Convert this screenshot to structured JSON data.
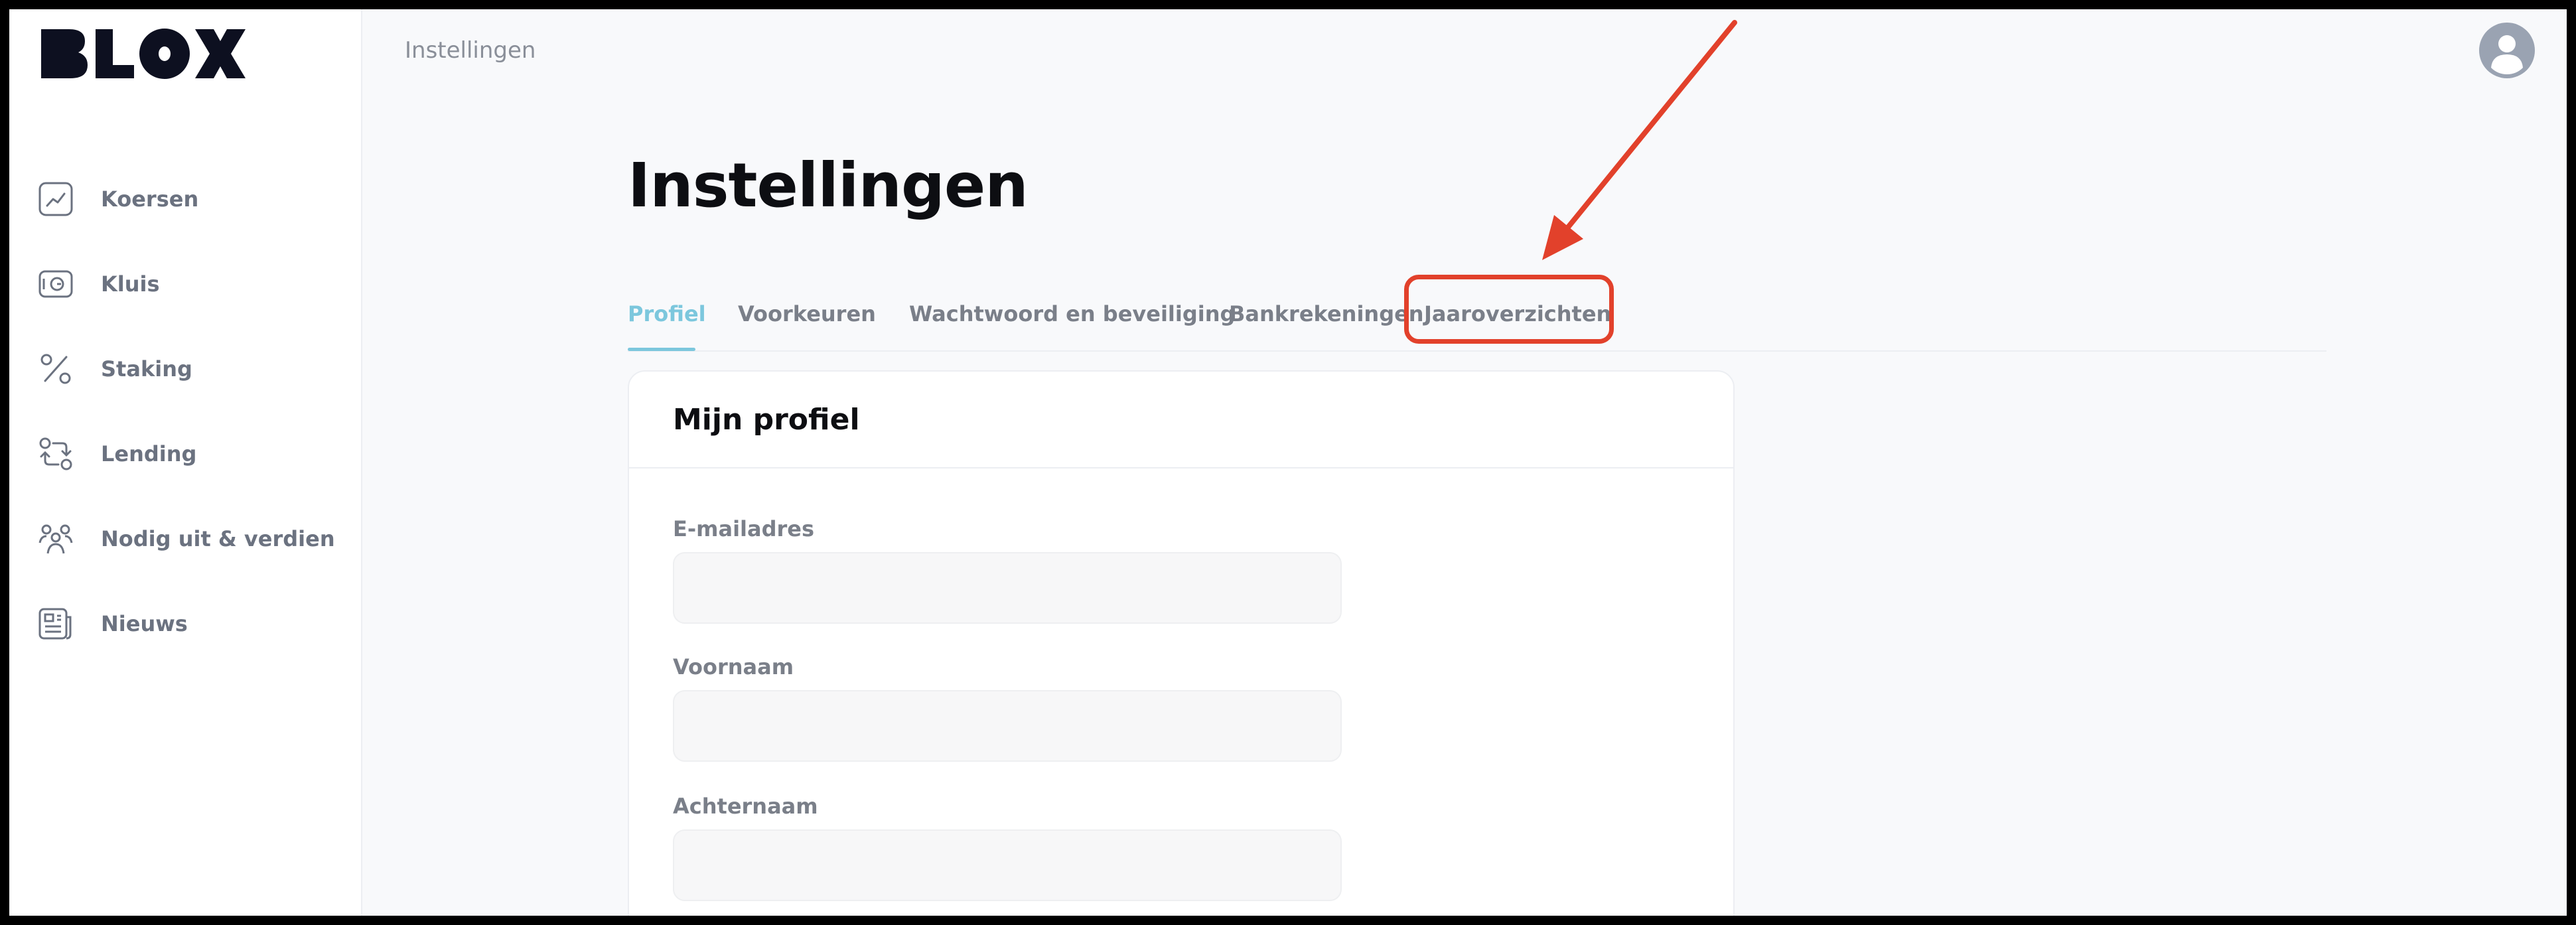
{
  "app": {
    "logo_text": "BLOX"
  },
  "header": {
    "breadcrumb": "Instellingen"
  },
  "sidebar": {
    "items": [
      {
        "label": "Koersen",
        "icon": "chart-icon"
      },
      {
        "label": "Kluis",
        "icon": "vault-icon"
      },
      {
        "label": "Staking",
        "icon": "percent-icon"
      },
      {
        "label": "Lending",
        "icon": "exchange-icon"
      },
      {
        "label": "Nodig uit & verdien",
        "icon": "users-icon"
      },
      {
        "label": "Nieuws",
        "icon": "newspaper-icon"
      }
    ]
  },
  "page": {
    "title": "Instellingen"
  },
  "tabs": [
    {
      "label": "Profiel",
      "active": true
    },
    {
      "label": "Voorkeuren",
      "active": false
    },
    {
      "label": "Wachtwoord en beveiliging",
      "active": false
    },
    {
      "label": "Bankrekeningen",
      "active": false
    },
    {
      "label": "Jaaroverzichten",
      "active": false
    }
  ],
  "profile_card": {
    "title": "Mijn profiel",
    "fields": [
      {
        "label": "E-mailadres",
        "value": ""
      },
      {
        "label": "Voornaam",
        "value": ""
      },
      {
        "label": "Achternaam",
        "value": ""
      }
    ]
  },
  "annotation": {
    "highlighted_tab": "Jaaroverzichten",
    "color": "#e2412b"
  },
  "colors": {
    "accent": "#7cc7dd",
    "annotation": "#e2412b",
    "text_dark": "#0d0e12",
    "text_muted": "#7a7f89"
  }
}
